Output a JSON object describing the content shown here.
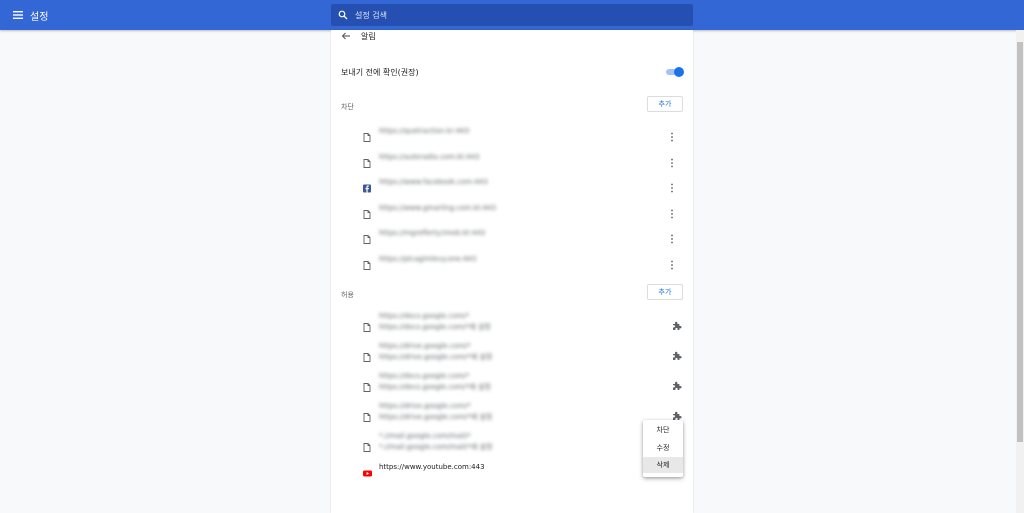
{
  "app": {
    "title": "설정"
  },
  "search": {
    "placeholder": "설정 검색"
  },
  "page": {
    "title": "알림",
    "ask_before_sending_label": "보내기 전에 확인(권장)",
    "ask_before_sending_enabled": true
  },
  "block": {
    "label": "차단",
    "add_label": "추가",
    "items": [
      {
        "url": "https://quetraction.kr:443",
        "icon": "file-icon"
      },
      {
        "url": "https://auteradia.com.kt:443",
        "icon": "file-icon"
      },
      {
        "url": "https://www.facebook.com:443",
        "icon": "facebook-icon"
      },
      {
        "url": "https://www.gmarling.com.kt:443",
        "icon": "file-icon"
      },
      {
        "url": "https://mgreflerty.tmob.kt:443",
        "icon": "file-icon"
      },
      {
        "url": "https://plcagimlevy.one:443",
        "icon": "file-icon"
      }
    ]
  },
  "allow": {
    "label": "허용",
    "add_label": "추가",
    "items": [
      {
        "url": "https://docs.google.com/*",
        "sub": "https://docs.google.com/*에 설정",
        "icon": "file-icon"
      },
      {
        "url": "https://drive.google.com/*",
        "sub": "https://drive.google.com/*에 설정",
        "icon": "file-icon"
      },
      {
        "url": "https://docs.google.com/*",
        "sub": "https://docs.google.com/*에 설정",
        "icon": "file-icon"
      },
      {
        "url": "https://drive.google.com/*",
        "sub": "https://drive.google.com/*에 설정",
        "icon": "file-icon"
      },
      {
        "url": "*://mail.google.com/mail/*",
        "sub": "*://mail.google.com/mail/*에 설정",
        "icon": "file-icon"
      },
      {
        "url": "https://www.youtube.com:443",
        "sub": "",
        "icon": "youtube-icon"
      }
    ]
  },
  "context_menu": {
    "items": [
      "차단",
      "수정",
      "삭제"
    ],
    "active_index": 2
  },
  "colors": {
    "header": "#3367d6",
    "search_bg": "#254fb0",
    "accent": "#1a73e8",
    "facebook": "#3b5998",
    "youtube": "#ff0000"
  }
}
